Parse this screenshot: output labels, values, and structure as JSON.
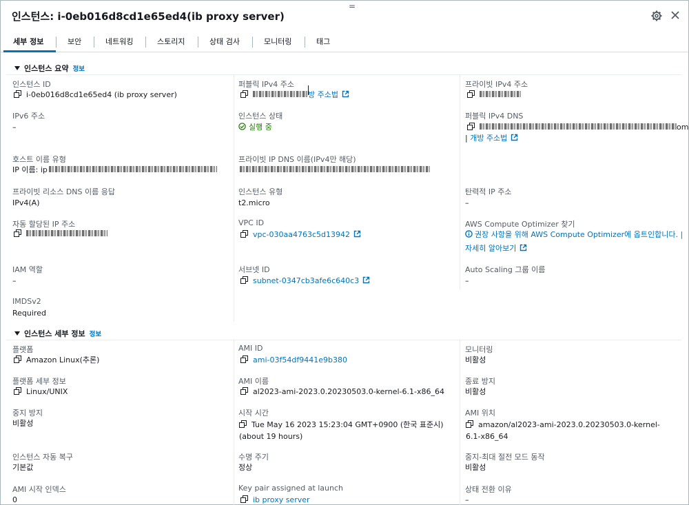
{
  "header": {
    "title": "인스턴스: i-0eb016d8cd1e65ed4(ib proxy server)",
    "drag_handle": "="
  },
  "tabs": [
    {
      "label": "세부 정보",
      "active": true
    },
    {
      "label": "보안"
    },
    {
      "label": "네트워킹"
    },
    {
      "label": "스토리지"
    },
    {
      "label": "상태 검사"
    },
    {
      "label": "모니터링"
    },
    {
      "label": "태그"
    }
  ],
  "summary": {
    "heading": "인스턴스 요약",
    "info": "정보",
    "instance_id": {
      "label": "인스턴스 ID",
      "value": "i-0eb016d8cd1e65ed4 (ib proxy server)"
    },
    "public_ipv4": {
      "label": "퍼블릭 IPv4 주소",
      "link": "방 주소법"
    },
    "private_ipv4": {
      "label": "프라이빗 IPv4 주소"
    },
    "ipv6": {
      "label": "IPv6 주소",
      "value": "–"
    },
    "state": {
      "label": "인스턴스 상태",
      "value": "실행 중"
    },
    "public_dns": {
      "label": "퍼블릭 IPv4 DNS",
      "suffix": "om",
      "link_prefix": "| ",
      "link": "개방 주소법"
    },
    "hostname_type": {
      "label": "호스트 이름 유형",
      "prefix": "IP 이름: ip"
    },
    "private_ip_dns": {
      "label": "프라이빗 IP DNS 이름(IPv4만 해당)"
    },
    "private_resource_dns": {
      "label": "프라이빗 리소스 DNS 이름 응답",
      "value": "IPv4(A)"
    },
    "instance_type": {
      "label": "인스턴스 유형",
      "value": "t2.micro"
    },
    "elastic_ip": {
      "label": "탄력적 IP 주소",
      "value": "–"
    },
    "auto_ip": {
      "label": "자동 할당된 IP 주소"
    },
    "vpc_id": {
      "label": "VPC ID",
      "value": "vpc-030aa4763c5d13942"
    },
    "optimizer": {
      "label": "AWS Compute Optimizer 찾기",
      "text": "권장 사항을 위해 AWS Compute Optimizer에 옵트인합니다. |",
      "more": "자세히 알아보기"
    },
    "iam_role": {
      "label": "IAM 역할",
      "value": "–"
    },
    "subnet_id": {
      "label": "서브넷 ID",
      "value": "subnet-0347cb3afe6c640c3"
    },
    "asg_name": {
      "label": "Auto Scaling 그룹 이름",
      "value": "–"
    },
    "imdsv2": {
      "label": "IMDSv2",
      "value": "Required"
    }
  },
  "details": {
    "heading": "인스턴스 세부 정보",
    "info": "정보",
    "platform": {
      "label": "플랫폼",
      "value": "Amazon Linux(추론)"
    },
    "ami_id": {
      "label": "AMI ID",
      "value": "ami-03f54df9441e9b380"
    },
    "monitoring": {
      "label": "모니터링",
      "value": "비활성"
    },
    "platform_detail": {
      "label": "플랫폼 세부 정보",
      "value": "Linux/UNIX"
    },
    "ami_name": {
      "label": "AMI 이름",
      "value": "al2023-ami-2023.0.20230503.0-kernel-6.1-x86_64"
    },
    "termination_protection": {
      "label": "종료 방지",
      "value": "비활성"
    },
    "stop_protection": {
      "label": "중지 방지",
      "value": "비활성"
    },
    "launch_time": {
      "label": "시작 시간",
      "value": "Tue May 16 2023 15:23:04 GMT+0900 (한국 표준시) (about 19 hours)"
    },
    "ami_location": {
      "label": "AMI 위치",
      "value": "amazon/al2023-ami-2023.0.20230503.0-kernel-6.1-x86_64"
    },
    "auto_recovery": {
      "label": "인스턴스 자동 복구",
      "value": "기본값"
    },
    "lifecycle": {
      "label": "수명 주기",
      "value": "정상"
    },
    "stop_hibernate": {
      "label": "중지-최대 절전 모드 동작",
      "value": "비활성"
    },
    "ami_launch_index": {
      "label": "AMI 시작 인덱스",
      "value": "0"
    },
    "key_pair": {
      "label": "Key pair assigned at launch",
      "value": "ib proxy server"
    },
    "state_transition": {
      "label": "상태 전환 이유",
      "value": "–"
    }
  },
  "colors": {
    "link": "#0073bb",
    "success": "#1d8102",
    "tab_indicator": "#0073bb"
  },
  "icons": [
    "gear-icon",
    "close-icon",
    "copy-icon",
    "external-link-icon",
    "check-circle-icon",
    "info-circle-icon",
    "caret-down-icon"
  ]
}
